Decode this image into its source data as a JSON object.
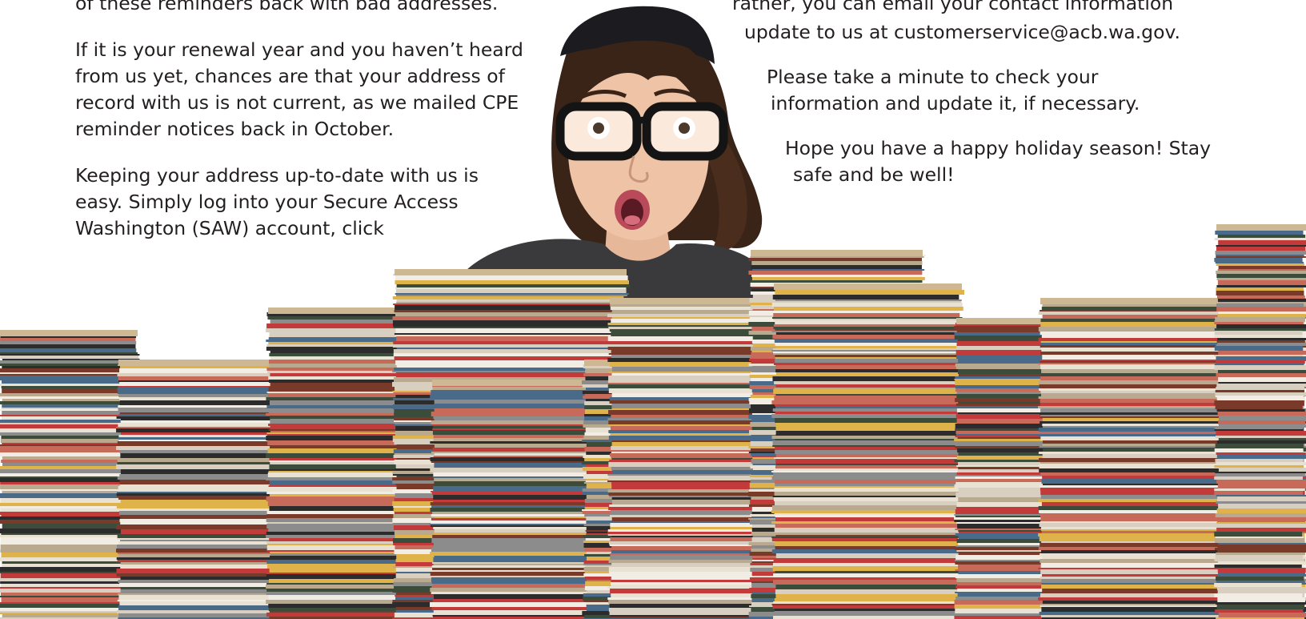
{
  "left_column": {
    "line_top": "of these reminders back with bad addresses.",
    "para1": [
      "If it is your renewal year and you haven’t heard",
      "from us yet, chances are that your address of",
      "record with us is not current, as we mailed CPE",
      "reminder notices back in October."
    ],
    "para2": [
      "Keeping your address up-to-date with us is",
      "easy. Simply log into your Secure Access",
      "Washington (SAW) account, click"
    ]
  },
  "right_column": {
    "line_top": "rather, you can email your contact information",
    "email_line": "update to us at customerservice@acb.wa.gov.",
    "para_check": [
      "Please take a minute to check your",
      "information and update it, if necessary."
    ],
    "para_holiday": [
      "Hope you have a happy holiday season! Stay",
      "safe and be well!"
    ]
  },
  "illustration": {
    "subject": "surprised-woman-with-glasses",
    "foreground": "stacks-of-mail"
  },
  "colors": {
    "text": "#231f20",
    "background": "#ffffff"
  }
}
